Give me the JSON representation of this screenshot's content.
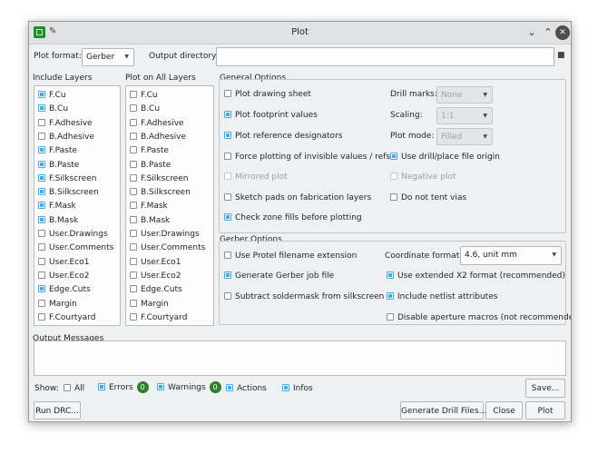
{
  "window": {
    "title": "Plot"
  },
  "plot_format": {
    "label": "Plot format:",
    "value": "Gerber"
  },
  "output_directory": {
    "label": "Output directory:",
    "value": ""
  },
  "include_layers": {
    "title": "Include Layers",
    "items": [
      {
        "label": "F.Cu",
        "checked": true
      },
      {
        "label": "B.Cu",
        "checked": true
      },
      {
        "label": "F.Adhesive",
        "checked": false
      },
      {
        "label": "B.Adhesive",
        "checked": false
      },
      {
        "label": "F.Paste",
        "checked": true
      },
      {
        "label": "B.Paste",
        "checked": true
      },
      {
        "label": "F.Silkscreen",
        "checked": true
      },
      {
        "label": "B.Silkscreen",
        "checked": true
      },
      {
        "label": "F.Mask",
        "checked": true
      },
      {
        "label": "B.Mask",
        "checked": true
      },
      {
        "label": "User.Drawings",
        "checked": false
      },
      {
        "label": "User.Comments",
        "checked": false
      },
      {
        "label": "User.Eco1",
        "checked": false
      },
      {
        "label": "User.Eco2",
        "checked": false
      },
      {
        "label": "Edge.Cuts",
        "checked": true
      },
      {
        "label": "Margin",
        "checked": false
      },
      {
        "label": "F.Courtyard",
        "checked": false
      }
    ]
  },
  "plot_all_layers": {
    "title": "Plot on All Layers",
    "items": [
      {
        "label": "F.Cu",
        "checked": false
      },
      {
        "label": "B.Cu",
        "checked": false
      },
      {
        "label": "F.Adhesive",
        "checked": false
      },
      {
        "label": "B.Adhesive",
        "checked": false
      },
      {
        "label": "F.Paste",
        "checked": false
      },
      {
        "label": "B.Paste",
        "checked": false
      },
      {
        "label": "F.Silkscreen",
        "checked": false
      },
      {
        "label": "B.Silkscreen",
        "checked": false
      },
      {
        "label": "F.Mask",
        "checked": false
      },
      {
        "label": "B.Mask",
        "checked": false
      },
      {
        "label": "User.Drawings",
        "checked": false
      },
      {
        "label": "User.Comments",
        "checked": false
      },
      {
        "label": "User.Eco1",
        "checked": false
      },
      {
        "label": "User.Eco2",
        "checked": false
      },
      {
        "label": "Edge.Cuts",
        "checked": false
      },
      {
        "label": "Margin",
        "checked": false
      },
      {
        "label": "F.Courtyard",
        "checked": false
      }
    ]
  },
  "general": {
    "title": "General Options",
    "plot_drawing_sheet": "Plot drawing sheet",
    "plot_footprint_values": "Plot footprint values",
    "plot_reference_designators": "Plot reference designators",
    "force_invisible": "Force plotting of invisible values / refs",
    "mirrored_plot": "Mirrored plot",
    "sketch_pads": "Sketch pads on fabrication layers",
    "check_zone_fills": "Check zone fills before plotting",
    "drill_marks_label": "Drill marks:",
    "drill_marks_value": "None",
    "scaling_label": "Scaling:",
    "scaling_value": "1:1",
    "plot_mode_label": "Plot mode:",
    "plot_mode_value": "Filled",
    "use_drill_origin": "Use drill/place file origin",
    "negative_plot": "Negative plot",
    "do_not_tent_vias": "Do not tent vias"
  },
  "gerber": {
    "title": "Gerber Options",
    "use_protel": "Use Protel filename extension",
    "generate_job_file": "Generate Gerber job file",
    "subtract_soldermask": "Subtract soldermask from silkscreen",
    "coord_format_label": "Coordinate format:",
    "coord_format_value": "4.6, unit mm",
    "use_x2": "Use extended X2 format (recommended)",
    "include_netlist": "Include netlist attributes",
    "disable_aperture": "Disable aperture macros (not recommended)"
  },
  "messages": {
    "title": "Output Messages",
    "show_label": "Show:",
    "all_label": "All",
    "errors_label": "Errors",
    "errors_count": "0",
    "warnings_label": "Warnings",
    "warnings_count": "0",
    "actions_label": "Actions",
    "infos_label": "Infos",
    "save_label": "Save..."
  },
  "footer": {
    "run_drc": "Run DRC...",
    "generate_drill": "Generate Drill Files...",
    "close": "Close",
    "plot": "Plot"
  },
  "colors": {
    "accent": "#3daee9",
    "badge": "#2d7d2d"
  }
}
